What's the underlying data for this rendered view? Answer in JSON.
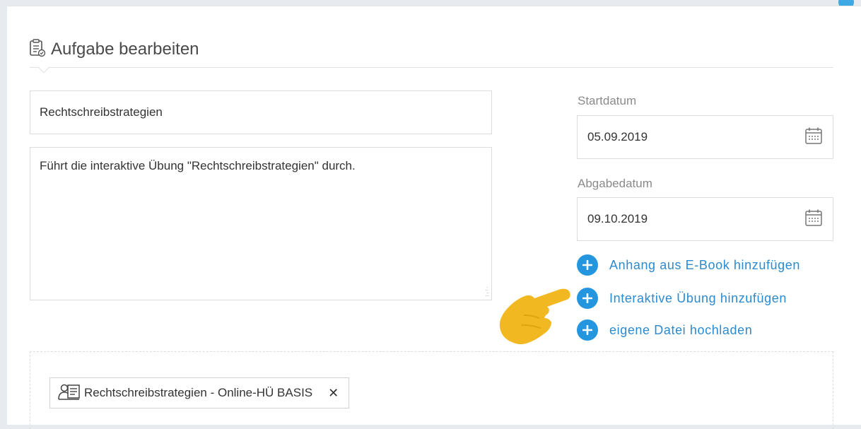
{
  "header": {
    "title": "Aufgabe bearbeiten"
  },
  "form": {
    "title_value": "Rechtschreibstrategien",
    "description_value": "Führt die interaktive Übung \"Rechtschreibstrategien\" durch."
  },
  "dates": {
    "start_label": "Startdatum",
    "start_value": "05.09.2019",
    "due_label": "Abgabedatum",
    "due_value": "09.10.2019"
  },
  "actions": [
    {
      "label": "Anhang aus E-Book hinzufügen",
      "icon": "plus-circle-icon"
    },
    {
      "label": "Interaktive Übung hinzufügen",
      "icon": "plus-circle-icon"
    },
    {
      "label": "eigene Datei hochladen",
      "icon": "plus-circle-icon"
    }
  ],
  "attachment": {
    "label": "Rechtschreibstrategien - Online-HÜ BASIS",
    "icon": "exercise-icon",
    "remove_symbol": "✕"
  },
  "colors": {
    "accent": "#2496e0",
    "link": "#2b8ad0",
    "hand_pointer": "#f2b821",
    "background": "#e7ebf0"
  }
}
